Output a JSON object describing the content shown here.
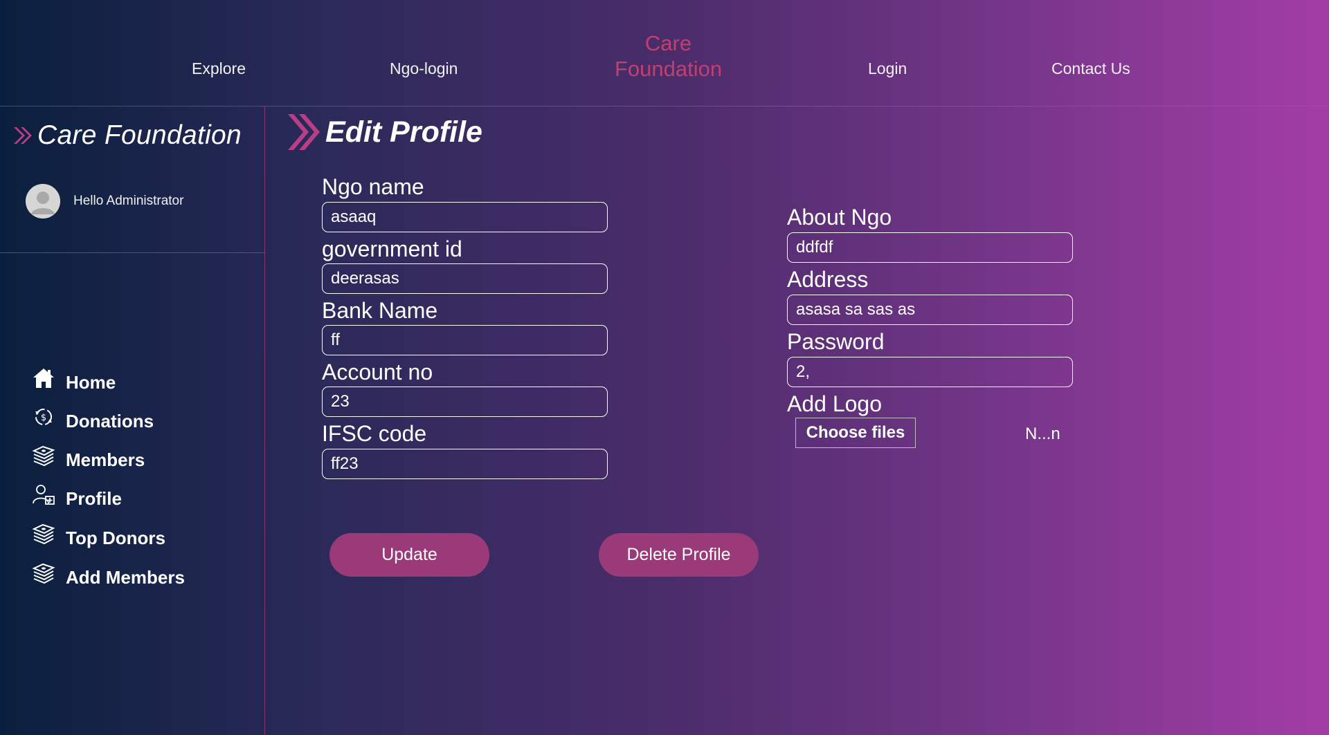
{
  "nav": {
    "links": [
      "Explore",
      "Ngo-login",
      "Login",
      "Contact Us"
    ],
    "brand_line1": "Care",
    "brand_line2": "Foundation"
  },
  "sidebar": {
    "brand": "Care Foundation",
    "greeting": "Hello Administrator",
    "items": [
      {
        "label": "Home",
        "icon": "home-icon"
      },
      {
        "label": "Donations",
        "icon": "donation-cycle-icon"
      },
      {
        "label": "Members",
        "icon": "money-stack-icon"
      },
      {
        "label": "Profile",
        "icon": "user-profile-icon"
      },
      {
        "label": "Top Donors",
        "icon": "money-stack-icon"
      },
      {
        "label": "Add Members",
        "icon": "money-stack-icon"
      }
    ]
  },
  "main": {
    "title": "Edit Profile",
    "left_fields": [
      {
        "label": "Ngo name",
        "value": "asaaq"
      },
      {
        "label": "government id",
        "value": "deerasas"
      },
      {
        "label": "Bank Name",
        "value": "ff"
      },
      {
        "label": "Account no",
        "value": "23"
      },
      {
        "label": "IFSC code",
        "value": "ff23"
      }
    ],
    "right_fields": [
      {
        "label": "About Ngo",
        "value": "ddfdf"
      },
      {
        "label": "Address",
        "value": "asasa sa sas as"
      },
      {
        "label": "Password",
        "value": "2,"
      }
    ],
    "logo": {
      "label": "Add Logo",
      "button": "Choose files",
      "file_status": "N...n"
    },
    "buttons": {
      "update": "Update",
      "delete": "Delete Profile"
    }
  },
  "colors": {
    "accent": "#9a3a78",
    "brand_pink": "#c0406f",
    "divider": "#d2468c",
    "gradient_start": "#0a1f3d",
    "gradient_end": "#a33da6"
  }
}
